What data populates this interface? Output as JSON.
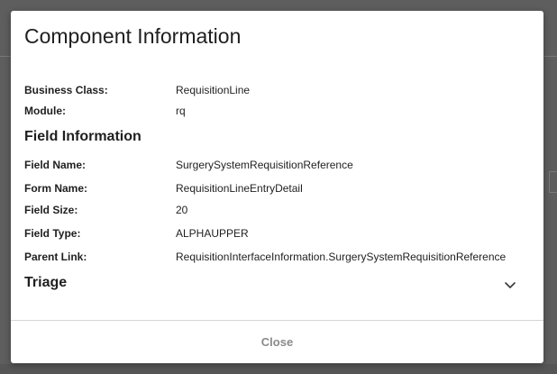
{
  "dialog": {
    "title": "Component Information",
    "close_label": "Close"
  },
  "component": {
    "business_class_label": "Business Class:",
    "business_class_value": "RequisitionLine",
    "module_label": "Module:",
    "module_value": "rq"
  },
  "field_information": {
    "heading": "Field Information",
    "rows": [
      {
        "label": "Field Name:",
        "value": "SurgerySystemRequisitionReference"
      },
      {
        "label": "Form Name:",
        "value": "RequisitionLineEntryDetail"
      },
      {
        "label": "Field Size:",
        "value": "20"
      },
      {
        "label": "Field Type:",
        "value": "ALPHAUPPER"
      },
      {
        "label": "Parent Link:",
        "value": "RequisitionInterfaceInformation.SurgerySystemRequisitionReference"
      }
    ]
  },
  "triage": {
    "heading": "Triage",
    "toggle_icon": "chevron-down-icon"
  },
  "colors": {
    "overlay": "#5e5e5e",
    "dialog_bg": "#ffffff",
    "text": "#1f1f1f",
    "close_text": "#8a8a8a",
    "divider": "#d6d6d6"
  }
}
